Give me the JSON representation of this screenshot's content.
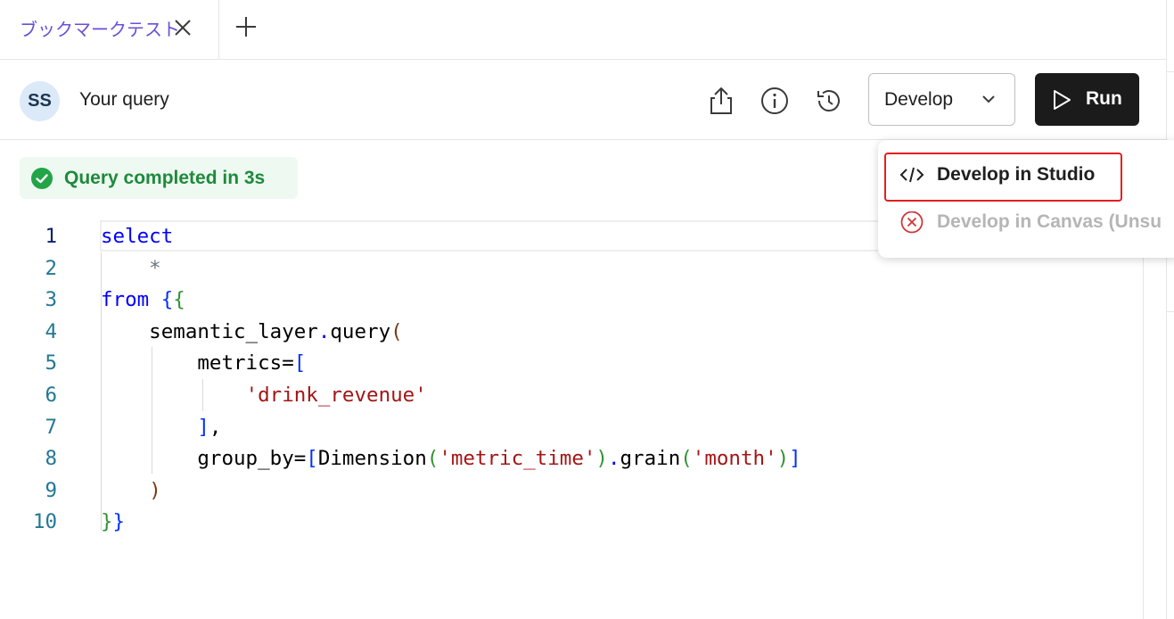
{
  "tabs": [
    {
      "label": "ブックマークテスト",
      "active": true
    }
  ],
  "header": {
    "avatar_initials": "SS",
    "query_title": "Your query",
    "develop_label": "Develop",
    "run_label": "Run"
  },
  "icons": {
    "share": "share-icon",
    "info": "info-icon",
    "history": "history-icon",
    "chevron": "chevron-down-icon",
    "run": "play-icon",
    "status": "check-circle-icon",
    "studio": "code-icon",
    "canvas": "x-circle-icon"
  },
  "status": {
    "text": "Query completed in 3s",
    "color": "#1e8a3b"
  },
  "menu": {
    "items": [
      {
        "label": "Develop in Studio",
        "enabled": true
      },
      {
        "label": "Develop in Canvas (Unsu",
        "enabled": false
      }
    ]
  },
  "editor": {
    "line_numbers": [
      "1",
      "2",
      "3",
      "4",
      "5",
      "6",
      "7",
      "8",
      "9",
      "10"
    ],
    "lines": [
      [
        [
          "kw",
          "select"
        ]
      ],
      [
        [
          "star",
          "    *"
        ]
      ],
      [
        [
          "kw",
          "from"
        ],
        [
          "punct",
          " "
        ],
        [
          "b1",
          "{"
        ],
        [
          "b2",
          "{"
        ]
      ],
      [
        [
          "punct",
          "    semantic_layer"
        ],
        [
          "kw",
          "."
        ],
        [
          "punct",
          "query"
        ],
        [
          "b3",
          "("
        ]
      ],
      [
        [
          "punct",
          "        metrics="
        ],
        [
          "b1",
          "["
        ]
      ],
      [
        [
          "punct",
          "            "
        ],
        [
          "str",
          "'drink_revenue'"
        ]
      ],
      [
        [
          "punct",
          "        "
        ],
        [
          "b1",
          "]"
        ],
        [
          "punct",
          ","
        ]
      ],
      [
        [
          "punct",
          "        group_by="
        ],
        [
          "b1",
          "["
        ],
        [
          "punct",
          "Dimension"
        ],
        [
          "b2",
          "("
        ],
        [
          "str",
          "'metric_time'"
        ],
        [
          "b2",
          ")"
        ],
        [
          "kw",
          "."
        ],
        [
          "punct",
          "grain"
        ],
        [
          "b2",
          "("
        ],
        [
          "str",
          "'month'"
        ],
        [
          "b2",
          ")"
        ],
        [
          "b1",
          "]"
        ]
      ],
      [
        [
          "punct",
          "    "
        ],
        [
          "b3",
          ")"
        ]
      ],
      [
        [
          "b2",
          "}"
        ],
        [
          "b1",
          "}"
        ]
      ]
    ]
  }
}
